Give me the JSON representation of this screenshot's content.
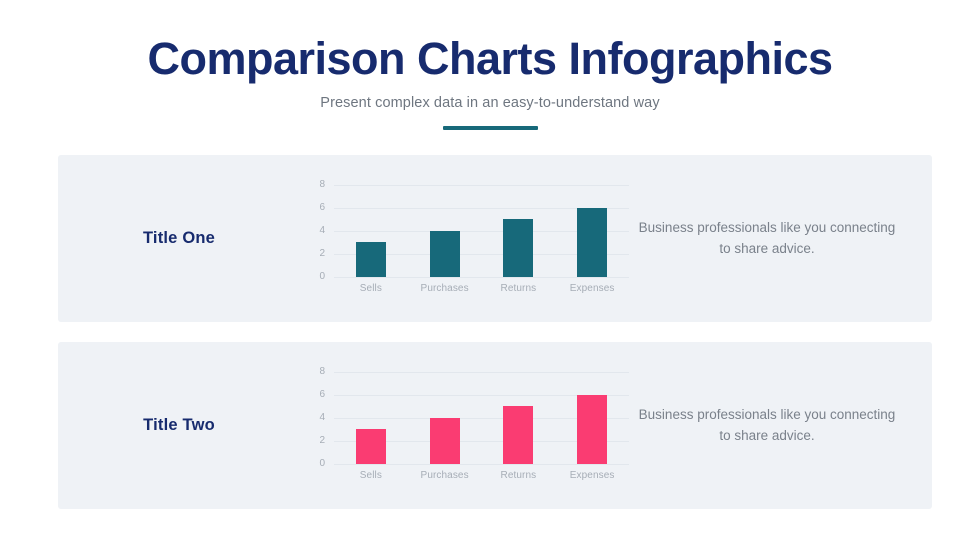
{
  "header": {
    "title": "Comparison Charts Infographics",
    "subtitle": "Present complex data in an easy-to-understand way",
    "accent_color": "#17697A",
    "title_color": "#172B6E"
  },
  "panels": [
    {
      "title": "Title One",
      "description": "Business professionals like you connecting to share advice.",
      "bar_color": "#17697A"
    },
    {
      "title": "Title Two",
      "description": "Business professionals like you connecting to share advice.",
      "bar_color": "#FA3C72"
    }
  ],
  "chart_data": [
    {
      "type": "bar",
      "title": "Title One",
      "categories": [
        "Sells",
        "Purchases",
        "Returns",
        "Expenses"
      ],
      "values": [
        3,
        4,
        5,
        6
      ],
      "yticks": [
        0,
        2,
        4,
        6,
        8
      ],
      "ylim": [
        0,
        8
      ],
      "xlabel": "",
      "ylabel": "",
      "grid": true,
      "legend": "none",
      "color": "#17697A"
    },
    {
      "type": "bar",
      "title": "Title Two",
      "categories": [
        "Sells",
        "Purchases",
        "Returns",
        "Expenses"
      ],
      "values": [
        3,
        4,
        5,
        6
      ],
      "yticks": [
        0,
        2,
        4,
        6,
        8
      ],
      "ylim": [
        0,
        8
      ],
      "xlabel": "",
      "ylabel": "",
      "grid": true,
      "legend": "none",
      "color": "#FA3C72"
    }
  ]
}
